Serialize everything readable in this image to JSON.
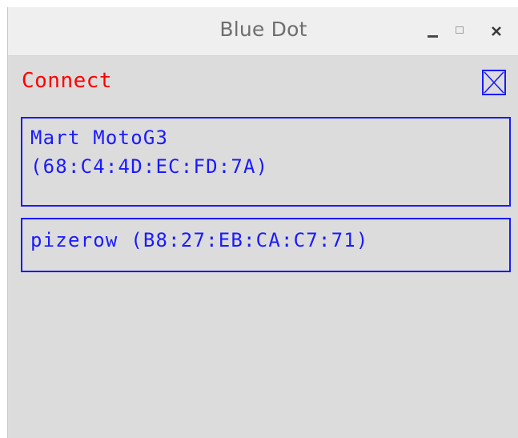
{
  "window": {
    "title": "Blue Dot"
  },
  "controls": {
    "minimize_icon": "minimize-icon",
    "maximize_icon": "maximize-icon",
    "close_icon": "close-icon"
  },
  "main": {
    "connect_label": "Connect",
    "connect_color": "#ff0000",
    "accent_color": "#1a1aff",
    "devices": [
      {
        "name": "Mart MotoG3",
        "address": "(68:C4:4D:EC:FD:7A)"
      },
      {
        "label": "pizerow (B8:27:EB:CA:C7:71)"
      }
    ]
  }
}
